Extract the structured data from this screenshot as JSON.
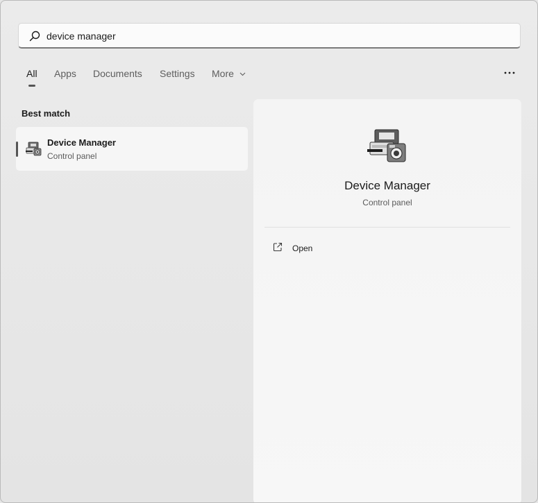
{
  "search": {
    "value": "device manager",
    "icon": "search-icon"
  },
  "tabs": [
    {
      "label": "All",
      "active": true
    },
    {
      "label": "Apps",
      "active": false
    },
    {
      "label": "Documents",
      "active": false
    },
    {
      "label": "Settings",
      "active": false
    },
    {
      "label": "More",
      "active": false
    }
  ],
  "more_options_icon": "ellipsis-icon",
  "results": {
    "section_title": "Best match",
    "items": [
      {
        "name": "Device Manager",
        "subtitle": "Control panel",
        "icon": "device-manager-icon"
      }
    ]
  },
  "preview": {
    "title": "Device Manager",
    "subtitle": "Control panel",
    "icon": "device-manager-icon",
    "actions": [
      {
        "label": "Open",
        "icon": "open-external-icon"
      }
    ]
  },
  "colors": {
    "background": "#e6e6e6",
    "panel": "#f6f6f6",
    "indicator": "#555555"
  }
}
